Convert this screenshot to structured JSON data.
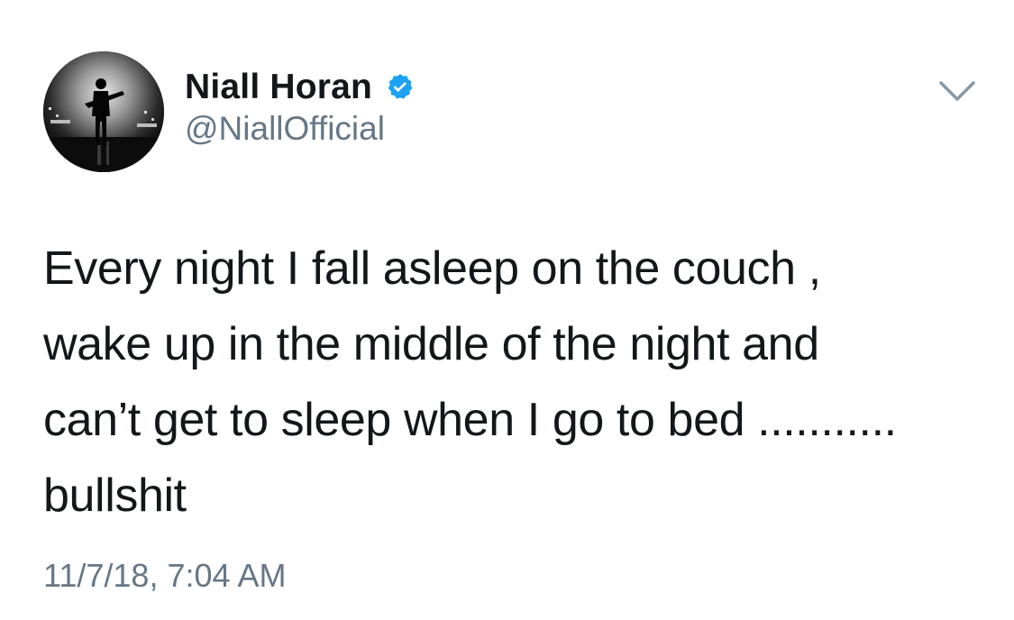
{
  "author": {
    "display_name": "Niall Horan",
    "handle": "@NiallOfficial",
    "verified": true,
    "verified_icon": "verified-badge-icon",
    "verified_color": "#1da1f2"
  },
  "menu": {
    "icon": "chevron-down-icon",
    "color": "#8899a6"
  },
  "tweet": {
    "lines": [
      "Every night I fall asleep on the couch ,",
      "wake up in the middle of the night and",
      "can’t get to sleep when I go to bed ...........",
      "bullshit"
    ],
    "timestamp": "11/7/18, 7:04 AM"
  },
  "colors": {
    "text": "#14171a",
    "secondary": "#657786",
    "background": "#ffffff"
  }
}
